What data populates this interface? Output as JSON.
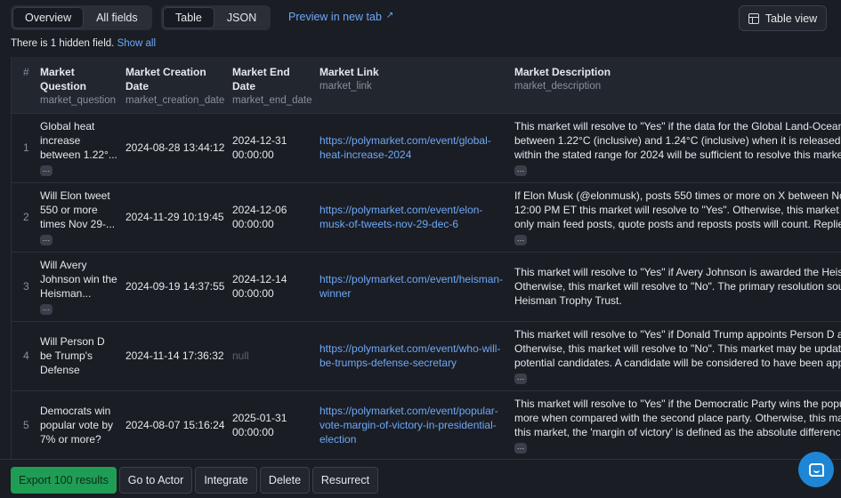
{
  "toolbar": {
    "view_tabs": [
      "Overview",
      "All fields"
    ],
    "format_tabs": [
      "Table",
      "JSON"
    ],
    "preview_link": "Preview in new tab",
    "table_view_label": "Table view"
  },
  "hidden_note": {
    "text": "There is 1 hidden field.",
    "link": "Show all"
  },
  "columns": [
    {
      "title": "#",
      "key": ""
    },
    {
      "title": "Market Question",
      "key": "market_question"
    },
    {
      "title": "Market Creation Date",
      "key": "market_creation_date"
    },
    {
      "title": "Market End Date",
      "key": "market_end_date"
    },
    {
      "title": "Market Link",
      "key": "market_link"
    },
    {
      "title": "Market Description",
      "key": "market_description"
    }
  ],
  "rows": [
    {
      "num": "1",
      "question": "Global heat increase between 1.22°...",
      "created": "2024-08-28 13:44:12",
      "end": "2024-12-31 00:00:00",
      "link": "https://polymarket.com/event/global-heat-increase-2024",
      "description": "This market will resolve to \"Yes\" if the data for the Global Land-Ocean T\nbetween 1.22°C (inclusive) and 1.24°C (inclusive) when it is released. Ot\nwithin the stated range for 2024 will be sufficient to resolve this market"
    },
    {
      "num": "2",
      "question": "Will Elon tweet 550 or more times Nov 29-...",
      "created": "2024-11-29 10:19:45",
      "end": "2024-12-06 00:00:00",
      "link": "https://polymarket.com/event/elon-musk-of-tweets-nov-29-dec-6",
      "description": "If Elon Musk (@elonmusk), posts 550 times or more on X between Nov\n12:00 PM ET this market will resolve to \"Yes\". Otherwise, this market wi\nonly main feed posts, quote posts and reposts posts will count. Replies"
    },
    {
      "num": "3",
      "question": "Will Avery Johnson win the Heisman...",
      "created": "2024-09-19 14:37:55",
      "end": "2024-12-14 00:00:00",
      "link": "https://polymarket.com/event/heisman-winner",
      "description": "This market will resolve to \"Yes\" if Avery Johnson is awarded the Heism\nOtherwise, this market will resolve to \"No\". The primary resolution sour\nHeisman Trophy Trust."
    },
    {
      "num": "4",
      "question": "Will Person D be Trump's Defense Secretary?",
      "created": "2024-11-14 17:36:32",
      "end": "null",
      "link": "https://polymarket.com/event/who-will-be-trumps-defense-secretary",
      "description": "This market will resolve to \"Yes\" if Donald Trump appoints Person D as\nOtherwise, this market will resolve to \"No\". This market may be update\npotential candidates. A candidate will be considered to have been appo"
    },
    {
      "num": "5",
      "question": "Democrats win popular vote by 7% or more?",
      "created": "2024-08-07 15:16:24",
      "end": "2025-01-31 00:00:00",
      "link": "https://polymarket.com/event/popular-vote-margin-of-victory-in-presidential-election",
      "description": "This market will resolve to \"Yes\" if the Democratic Party wins the popul\nmore when compared with the second place party. Otherwise, this mar\nthis market, the 'margin of victory' is defined as the absolute difference"
    }
  ],
  "bottom_actions": [
    "Export 100 results",
    "Go to Actor",
    "Integrate",
    "Delete",
    "Resurrect"
  ],
  "colors": {
    "accent_link": "#6ea8f7",
    "export_green": "#1f9d55",
    "chat_blue": "#1f86d6"
  },
  "icons": {
    "chat": "chat-icon",
    "table_view": "grid-icon",
    "external": "external-link-icon"
  }
}
